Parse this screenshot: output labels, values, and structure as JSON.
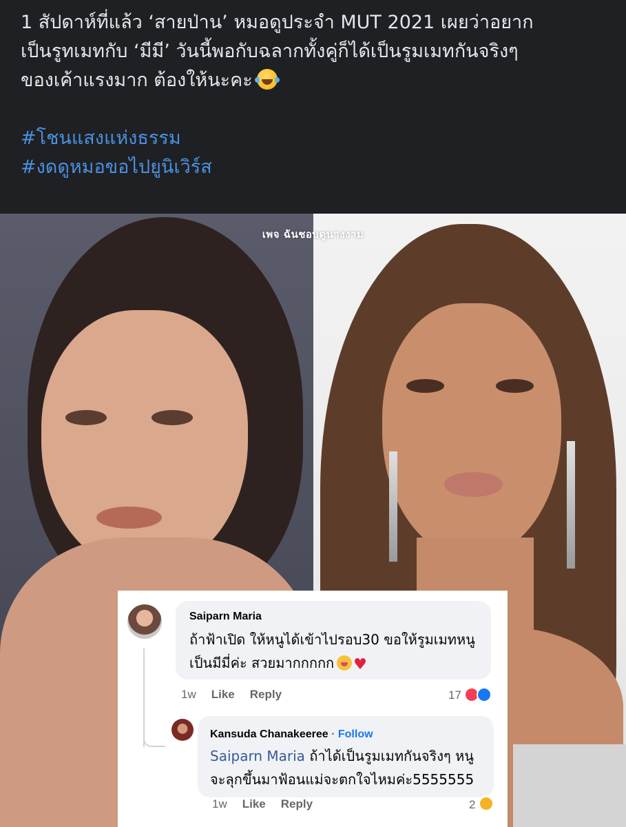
{
  "post": {
    "line1": "1 สัปดาห์ที่แล้ว ‘สายป่าน’ หมอดูประจำ MUT 2021 เผยว่าอยาก",
    "line2": "เป็นรูทเมทกับ ‘มีมี’ วันนี้พอกับฉลากทั้งคู่ก็ได้เป็นรูมเมทกันจริงๆ",
    "line3": "ของเค้าแรงมาก ต้องให้นะคะ",
    "emoji": "face-with-tears-of-joy",
    "hashtags": [
      "#โชนแสงแห่งธรรม",
      "#งดดูหมอขอไปยูนิเวิร์ส"
    ]
  },
  "image": {
    "watermark": "เพจ ฉันชอบดูนางงาม"
  },
  "comments": [
    {
      "author": "Saiparn Maria",
      "text_line1": "ถ้าฟ้าเปิด ให้หนูได้เข้าไปรอบ30 ขอให้รูมเมทหนู",
      "text_line2": "เป็นมีมี่ค่ะ สวยมากกกกก",
      "timestamp": "1w",
      "like_label": "Like",
      "reply_label": "Reply",
      "reaction_count": "17",
      "reactions": [
        "love",
        "like"
      ]
    },
    {
      "author": "Kansuda Chanakeeree",
      "separator": "·",
      "follow_label": "Follow",
      "mention": "Saiparn Maria",
      "text_line1": "ถ้าได้เป็นรูมเมทกันจริงๆ หนู",
      "text_line2": "จะลุกขึ้นมาฟ้อนแม่จะตกใจไหมค่ะ5555555",
      "timestamp": "1w",
      "like_label": "Like",
      "reply_label": "Reply",
      "reaction_count": "2",
      "reactions": [
        "haha"
      ]
    }
  ],
  "colors": {
    "background": "#1f2023",
    "post_text": "#e4e6eb",
    "hashtag": "#4a90e2",
    "bubble": "#f0f2f5",
    "follow": "#1877f2"
  }
}
